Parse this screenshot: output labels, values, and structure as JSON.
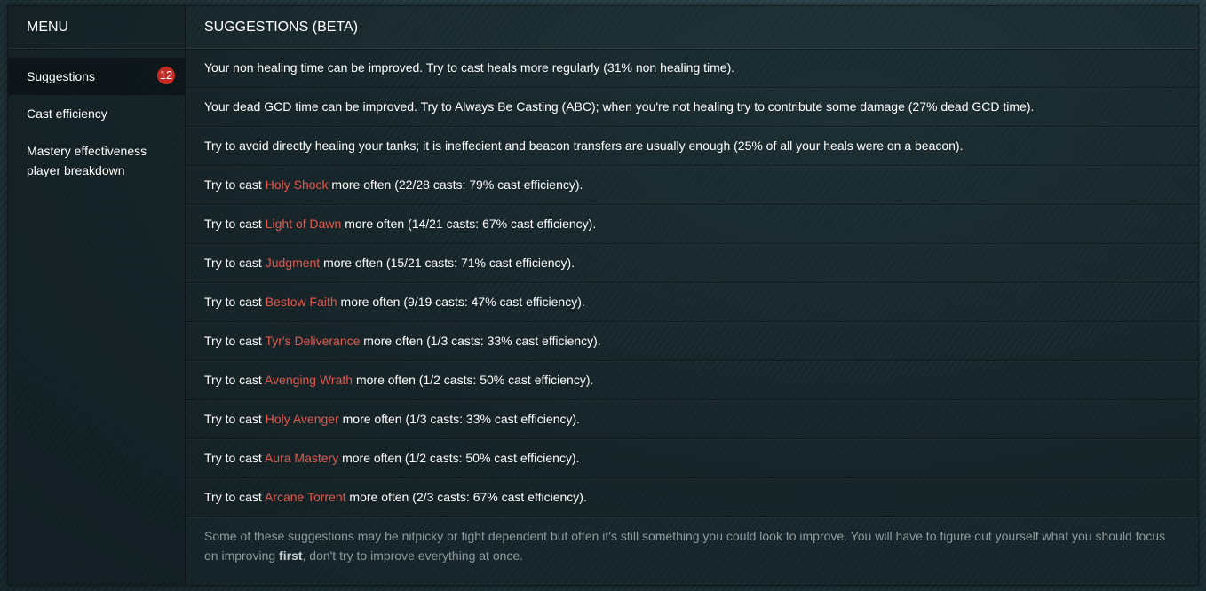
{
  "sidebar": {
    "title": "MENU",
    "items": [
      {
        "label": "Suggestions",
        "badge": "12"
      },
      {
        "label": "Cast efficiency"
      },
      {
        "label": "Mastery effectiveness player breakdown"
      }
    ]
  },
  "main": {
    "title": "SUGGESTIONS (BETA)",
    "suggestions": [
      {
        "text": "Your non healing time can be improved. Try to cast heals more regularly (31% non healing time)."
      },
      {
        "text": "Your dead GCD time can be improved. Try to Always Be Casting (ABC); when you're not healing try to contribute some damage (27% dead GCD time)."
      },
      {
        "text": "Try to avoid directly healing your tanks; it is ineffecient and beacon transfers are usually enough (25% of all your heals were on a beacon)."
      },
      {
        "prefix": "Try to cast ",
        "spell": "Holy Shock",
        "suffix": " more often (22/28 casts: 79% cast efficiency)."
      },
      {
        "prefix": "Try to cast ",
        "spell": "Light of Dawn",
        "suffix": " more often (14/21 casts: 67% cast efficiency)."
      },
      {
        "prefix": "Try to cast ",
        "spell": "Judgment",
        "suffix": " more often (15/21 casts: 71% cast efficiency)."
      },
      {
        "prefix": "Try to cast ",
        "spell": "Bestow Faith",
        "suffix": " more often (9/19 casts: 47% cast efficiency)."
      },
      {
        "prefix": "Try to cast ",
        "spell": "Tyr's Deliverance",
        "suffix": " more often (1/3 casts: 33% cast efficiency)."
      },
      {
        "prefix": "Try to cast ",
        "spell": "Avenging Wrath",
        "suffix": " more often (1/2 casts: 50% cast efficiency)."
      },
      {
        "prefix": "Try to cast ",
        "spell": "Holy Avenger",
        "suffix": " more often (1/3 casts: 33% cast efficiency)."
      },
      {
        "prefix": "Try to cast ",
        "spell": "Aura Mastery",
        "suffix": " more often (1/2 casts: 50% cast efficiency)."
      },
      {
        "prefix": "Try to cast ",
        "spell": "Arcane Torrent",
        "suffix": " more often (2/3 casts: 67% cast efficiency)."
      }
    ],
    "footer": {
      "before": "Some of these suggestions may be nitpicky or fight dependent but often it's still something you could look to improve. You will have to figure out yourself what you should focus on improving ",
      "emphasis": "first",
      "after": ", don't try to improve everything at once."
    }
  },
  "colors": {
    "spell_link": "#e05a4e",
    "badge": "#c42b25",
    "muted_text": "#8f9a9c"
  }
}
